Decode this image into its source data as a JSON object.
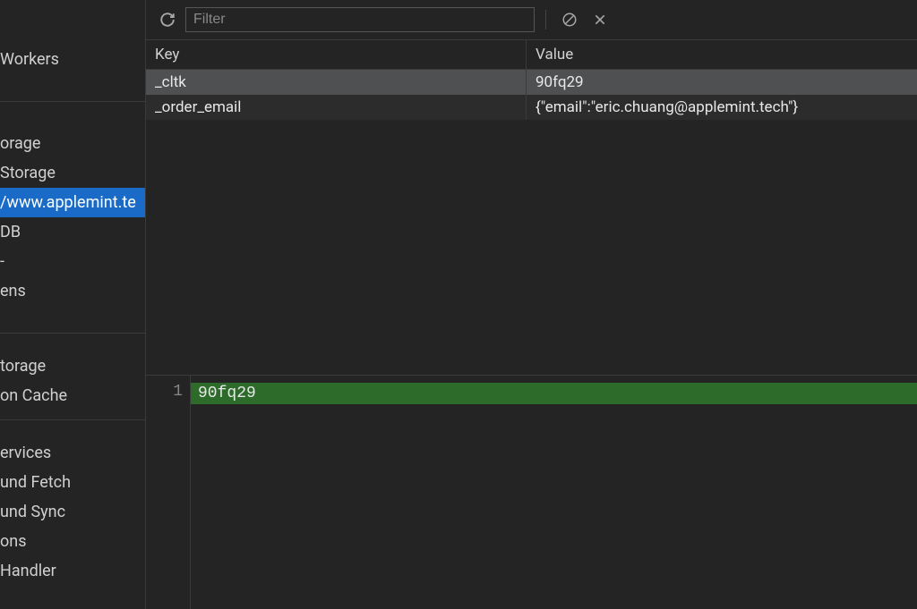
{
  "sidebar": {
    "items": [
      {
        "label": "Workers"
      }
    ],
    "storage_items": [
      {
        "label": "orage"
      },
      {
        "label": " Storage"
      },
      {
        "label": "/www.applemint.te",
        "selected": true
      },
      {
        "label": "DB"
      },
      {
        "label": "-"
      },
      {
        "label": "ens"
      }
    ],
    "cache_items": [
      {
        "label": "torage"
      },
      {
        "label": "on Cache"
      }
    ],
    "bg_items": [
      {
        "label": "ervices"
      },
      {
        "label": "und Fetch"
      },
      {
        "label": "und Sync"
      },
      {
        "label": "ons"
      },
      {
        "label": " Handler"
      }
    ]
  },
  "toolbar": {
    "filter_placeholder": "Filter"
  },
  "table": {
    "headers": {
      "key": "Key",
      "value": "Value"
    },
    "rows": [
      {
        "key": "_cltk",
        "value": "90fq29",
        "selected": true
      },
      {
        "key": "_order_email",
        "value": "{\"email\":\"eric.chuang@applemint.tech\"}"
      }
    ]
  },
  "detail": {
    "line_number": "1",
    "content": "90fq29"
  }
}
